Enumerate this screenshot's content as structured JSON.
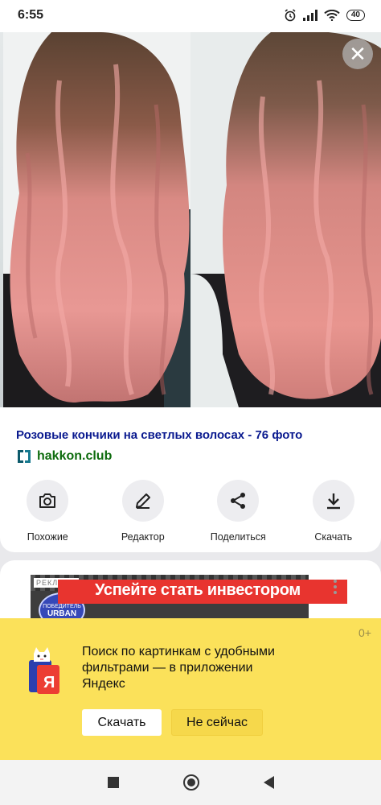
{
  "status_bar": {
    "time": "6:55",
    "battery": "40"
  },
  "image": {
    "description_icon": "close-icon"
  },
  "result": {
    "title": "Розовые кончики на светлых волосах - 76 фото",
    "source": "hakkon.club"
  },
  "actions": [
    {
      "label": "Похожие",
      "icon": "camera-search-icon"
    },
    {
      "label": "Редактор",
      "icon": "pencil-icon"
    },
    {
      "label": "Поделиться",
      "icon": "share-icon"
    },
    {
      "label": "Скачать",
      "icon": "download-icon"
    }
  ],
  "ad": {
    "label": "РЕКЛАМА",
    "badge_top": "ПОБЕДИТЕЛЬ",
    "badge_main": "URBAN",
    "headline": "Успейте стать инвестором"
  },
  "promo": {
    "age_rating": "0+",
    "text": "Поиск по картинкам с удобными\nфильтрами — в приложении\nЯндекс",
    "primary_button": "Скачать",
    "secondary_button": "Не сейчас"
  },
  "colors": {
    "title_link": "#0a1a8f",
    "source_green": "#0d6b0d",
    "promo_yellow": "#fbe15a",
    "ad_red": "#e8342f"
  }
}
